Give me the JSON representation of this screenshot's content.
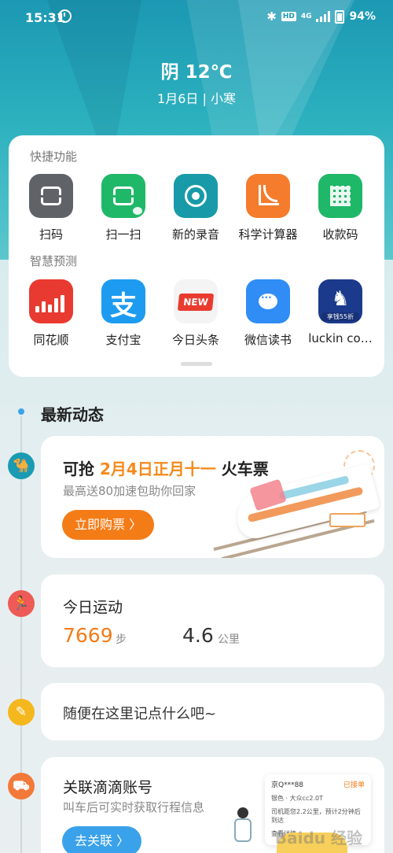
{
  "status_bar": {
    "time": "15:31",
    "network": "4G",
    "hd": "HD",
    "battery": "94%"
  },
  "header": {
    "weather": "阴 12℃",
    "date": "1月6日 | 小寒"
  },
  "quick_functions": {
    "title": "快捷功能",
    "items": [
      {
        "label": "扫码",
        "icon": "scan-code-icon",
        "color": "#5f6368"
      },
      {
        "label": "扫一扫",
        "icon": "scan-icon",
        "color": "#1fb868"
      },
      {
        "label": "新的录音",
        "icon": "record-icon",
        "color": "#189aa8"
      },
      {
        "label": "科学计算器",
        "icon": "calculator-icon",
        "color": "#f47c2c"
      },
      {
        "label": "收款码",
        "icon": "qr-code-icon",
        "color": "#1fb868"
      }
    ]
  },
  "smart_prediction": {
    "title": "智慧预测",
    "items": [
      {
        "label": "同花顺",
        "icon": "tonghuashun-icon",
        "color": "#e83a30"
      },
      {
        "label": "支付宝",
        "icon": "alipay-icon",
        "color": "#1d9bf0"
      },
      {
        "label": "今日头条",
        "icon": "toutiao-icon",
        "color": "#f4f4f4",
        "badge": "NEW"
      },
      {
        "label": "微信读书",
        "icon": "weread-icon",
        "color": "#2f8df5"
      },
      {
        "label": "luckin co…",
        "icon": "luckin-icon",
        "color": "#1b3a8c",
        "tag": "享钱55折"
      }
    ]
  },
  "timeline": {
    "title": "最新动态",
    "train": {
      "title_prefix": "可抢 ",
      "title_highlight": "2月4日正月十一",
      "title_suffix": " 火车票",
      "subtitle": "最高送80加速包助你回家",
      "button": "立即购票 〉"
    },
    "steps": {
      "title": "今日运动",
      "steps_value": "7669",
      "steps_unit": "步",
      "distance_value": "4.6",
      "distance_unit": "公里"
    },
    "note": {
      "text": "随便在这里记点什么吧~"
    },
    "didi": {
      "title": "关联滴滴账号",
      "subtitle": "叫车后可实时获取行程信息",
      "button": "去关联 〉",
      "card_plate": "京Q***88",
      "card_status": "已接单",
      "card_car": "银色 · 大众cc2.0T",
      "card_info": "司机距您2.2公里，预计2分钟后到达",
      "card_link": "查看详情"
    }
  },
  "watermark": "Baidu 经验"
}
